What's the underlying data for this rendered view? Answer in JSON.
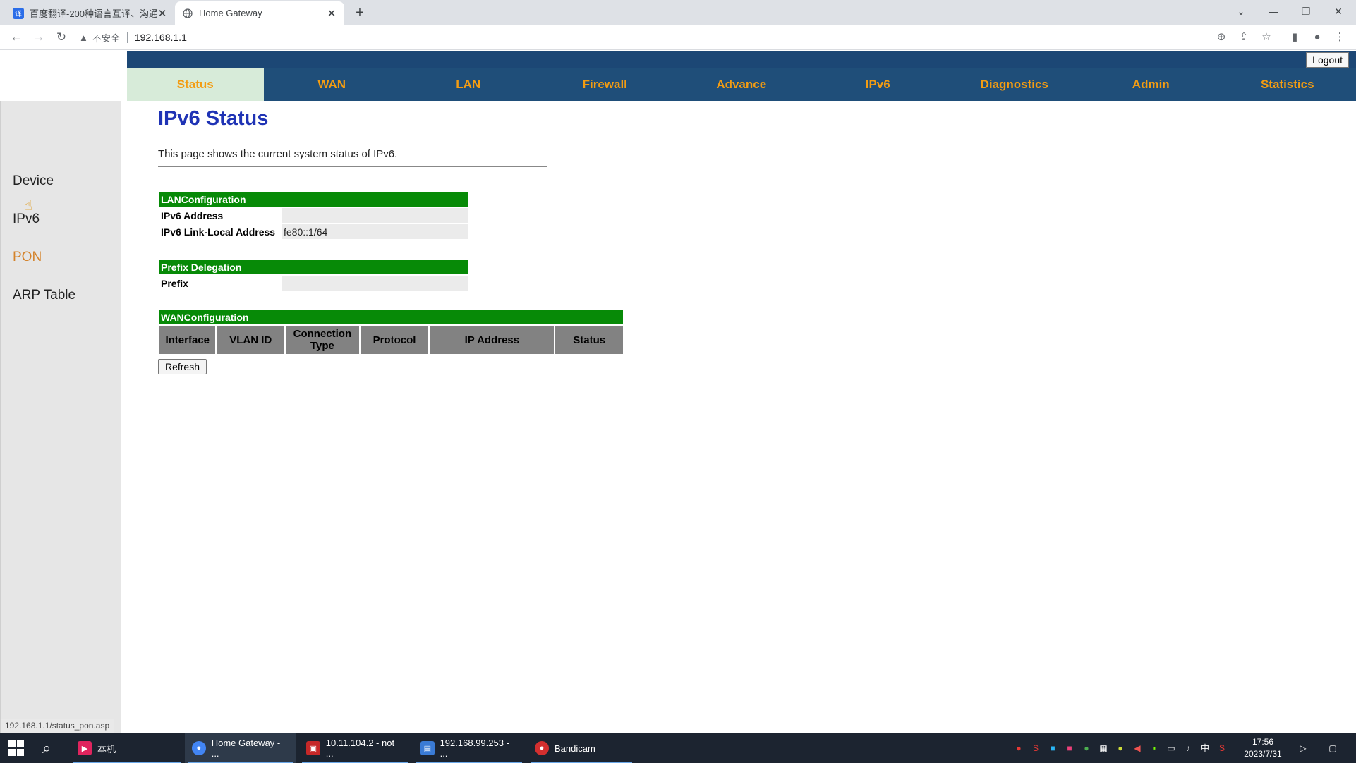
{
  "browser": {
    "tabs": [
      {
        "title": "百度翻译-200种语言互译、沟通",
        "active": false
      },
      {
        "title": "Home Gateway",
        "active": true
      }
    ],
    "security_label": "不安全",
    "url": "192.168.1.1"
  },
  "router": {
    "logout_label": "Logout",
    "nav": [
      "Status",
      "WAN",
      "LAN",
      "Firewall",
      "Advance",
      "IPv6",
      "Diagnostics",
      "Admin",
      "Statistics"
    ],
    "active_nav": "Status",
    "sidebar": [
      "Device",
      "IPv6",
      "PON",
      "ARP Table"
    ],
    "page_title": "IPv6 Status",
    "description": "This page shows the current system status of IPv6.",
    "lan": {
      "header": "LANConfiguration",
      "rows": [
        {
          "label": "IPv6 Address",
          "value": ""
        },
        {
          "label": "IPv6 Link-Local Address",
          "value": "fe80::1/64"
        }
      ]
    },
    "prefix": {
      "header": "Prefix Delegation",
      "rows": [
        {
          "label": "Prefix",
          "value": ""
        }
      ]
    },
    "wan": {
      "header": "WANConfiguration",
      "columns": [
        "Interface",
        "VLAN ID",
        "Connection Type",
        "Protocol",
        "IP Address",
        "Status"
      ]
    },
    "refresh_label": "Refresh",
    "status_url": "192.168.1.1/status_pon.asp"
  },
  "taskbar": {
    "items": [
      {
        "label": "本机",
        "color": "#e0245e"
      },
      {
        "label": "Home Gateway - ...",
        "color": "#4285f4"
      },
      {
        "label": "10.11.104.2 - not ...",
        "color": "#c62828"
      },
      {
        "label": "192.168.99.253 - ...",
        "color": "#3a7bd5"
      },
      {
        "label": "Bandicam",
        "color": "#d32f2f"
      }
    ],
    "ime": "中",
    "time": "17:56",
    "date": "2023/7/31"
  },
  "colors": {
    "nav_bg": "#1f4e79",
    "nav_text": "#f39c12",
    "section_header": "#078a07",
    "title": "#1f33b5"
  }
}
